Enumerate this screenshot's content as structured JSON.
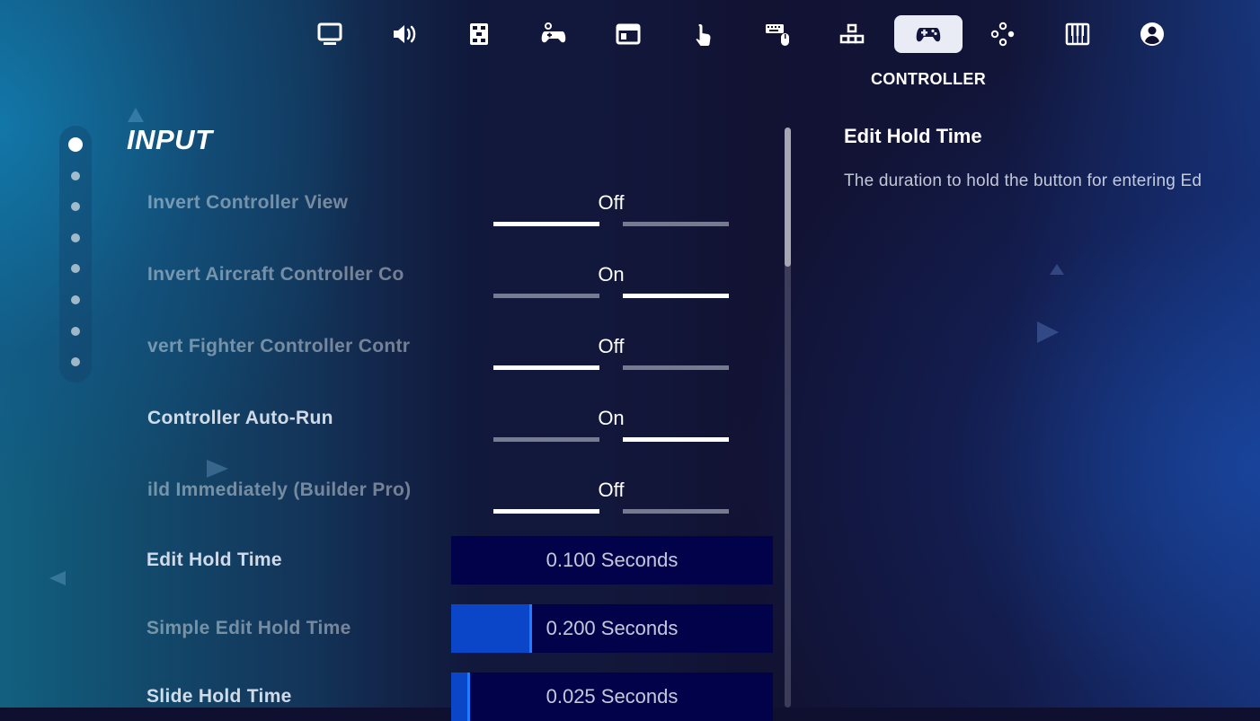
{
  "nav": {
    "tabs": [
      {
        "icon": "monitor-icon",
        "active": false
      },
      {
        "icon": "speaker-icon",
        "active": false
      },
      {
        "icon": "accessibility-grid-icon",
        "active": false
      },
      {
        "icon": "gamepad-touch-icon",
        "active": false
      },
      {
        "icon": "window-icon",
        "active": false
      },
      {
        "icon": "touch-hand-icon",
        "active": false
      },
      {
        "icon": "keyboard-mouse-icon",
        "active": false
      },
      {
        "icon": "blocks-icon",
        "active": false
      },
      {
        "icon": "controller-icon",
        "active": true
      },
      {
        "icon": "dpad-icon",
        "active": false
      },
      {
        "icon": "piano-keys-icon",
        "active": false
      },
      {
        "icon": "account-icon",
        "active": false
      }
    ],
    "active_label": "CONTROLLER"
  },
  "page_dots": {
    "count": 8,
    "active_index": 0
  },
  "section": {
    "title": "INPUT"
  },
  "settings": {
    "invert_view": {
      "label": "Invert Controller View",
      "value": "Off",
      "selected": 0
    },
    "invert_aircraft": {
      "label": "Invert Aircraft Controller Co",
      "value": "On",
      "selected": 1
    },
    "invert_fighter": {
      "label": "vert Fighter Controller Contr",
      "value": "Off",
      "selected": 0
    },
    "auto_run": {
      "label": "Controller Auto-Run",
      "value": "On",
      "selected": 1
    },
    "build_immediately": {
      "label": "ild Immediately (Builder Pro)",
      "value": "Off",
      "selected": 0
    },
    "edit_hold": {
      "label": "Edit Hold Time",
      "value": "0.100 Seconds",
      "fraction": 0.0
    },
    "simple_edit_hold": {
      "label": "Simple Edit Hold Time",
      "value": "0.200 Seconds",
      "fraction": 0.25
    },
    "slide_hold": {
      "label": "Slide Hold Time",
      "value": "0.025 Seconds",
      "fraction": 0.06
    }
  },
  "scroll": {
    "position_fraction": 0.0
  },
  "description": {
    "title": "Edit Hold Time",
    "text": "The duration to hold the button for entering Ed"
  },
  "colors": {
    "slider_bg": "#02024a",
    "slider_fill": "#0b46c8",
    "active_tab_bg": "#e9ecf5"
  }
}
